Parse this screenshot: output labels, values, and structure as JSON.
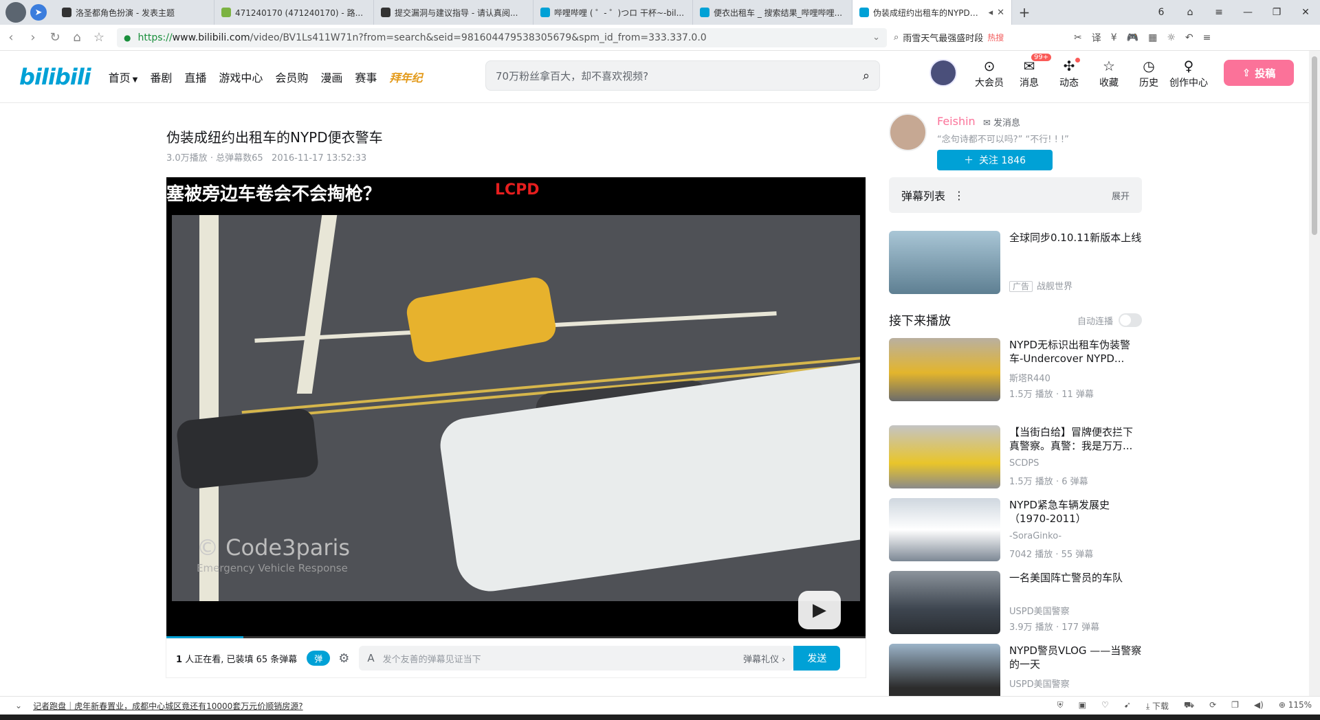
{
  "browser": {
    "tabs": [
      {
        "title": "洛圣都角色扮演 - 发表主题",
        "color": "#333333"
      },
      {
        "title": "471240170 (471240170) - 路...",
        "color": "#7cb342"
      },
      {
        "title": "提交漏洞与建议指导 - 请认真阅...",
        "color": "#333333"
      },
      {
        "title": "哔哩哔哩 ( ゜- ゜)つロ 干杯~-bil...",
        "color": "#00a1d6"
      },
      {
        "title": "便衣出租车 _ 搜索结果_哔哩哔哩...",
        "color": "#00a1d6"
      },
      {
        "title": "伪装成纽约出租车的NYPD便...",
        "color": "#00a1d6"
      }
    ],
    "tab_count": "6",
    "url_scheme": "https://",
    "url_host": "www.bilibili.com",
    "url_path": "/video/BV1Ls411W71n?from=search&seid=981604479538305679&spm_id_from=333.337.0.0",
    "search_hint": "雨雪天气最强盛时段",
    "search_hot": "热搜",
    "zoom": "115%",
    "download_label": "下载"
  },
  "site": {
    "logo": "bilibili",
    "nav": [
      "首页",
      "番剧",
      "直播",
      "游戏中心",
      "会员购",
      "漫画",
      "赛事"
    ],
    "nav_special": "拜年纪",
    "search_placeholder": "70万粉丝拿百大，却不喜欢视频?",
    "header_items": [
      {
        "label": "大会员",
        "icon": "vip-icon"
      },
      {
        "label": "消息",
        "icon": "message-icon",
        "badge": "99+"
      },
      {
        "label": "动态",
        "icon": "dynamic-icon"
      },
      {
        "label": "收藏",
        "icon": "favorite-icon"
      },
      {
        "label": "历史",
        "icon": "history-icon"
      },
      {
        "label": "创作中心",
        "icon": "creator-icon"
      }
    ],
    "upload_label": "投稿"
  },
  "video": {
    "title": "伪装成纽约出租车的NYPD便衣警车",
    "views": "3.0万播放",
    "danmaku_total": "总弹幕数65",
    "date": "2016-11-17 13:52:33",
    "overlay_caption": "塞被旁边车卷会不会掏枪？",
    "overlay_label": "LCPD",
    "watermark": "© Code3paris",
    "watermark_sub": "Emergency Vehicle Response",
    "progress": 0.11,
    "watching_count": "1",
    "watching_text": "人正在看, 已装填 65 条弹幕",
    "danmaku_toggle": "弹",
    "danmaku_placeholder": "发个友善的弹幕见证当下",
    "danmaku_etiquette": "弹幕礼仪",
    "send_label": "发送"
  },
  "uploader": {
    "name": "Feishin",
    "message_label": "发消息",
    "signature": "“念句诗都不可以吗?” “不行! ! !”",
    "follow_label": "关注 1846"
  },
  "sidebar": {
    "danmaku_list_label": "弹幕列表",
    "expand_label": "展开",
    "ad": {
      "title": "全球同步0.10.11新版本上线",
      "tag": "广告",
      "source": "战舰世界"
    },
    "next_label": "接下来播放",
    "autoplay_label": "自动连播",
    "recommendations": [
      {
        "title": "NYPD无标识出租车伪装警车-Undercover NYPD...",
        "author": "斯塔R440",
        "stats": "1.5万 播放 · 11 弹幕"
      },
      {
        "title": "【当街白给】冒牌便衣拦下真警察。真警：我是万万...",
        "author": "SCDPS",
        "stats": "1.5万 播放 · 6 弹幕"
      },
      {
        "title": "NYPD紧急车辆发展史（1970-2011）",
        "author": "-SoraGinko-",
        "stats": "7042 播放 · 55 弹幕"
      },
      {
        "title": "一名美国阵亡警员的车队",
        "author": "USPD美国警察",
        "stats": "3.9万 播放 · 177 弹幕"
      },
      {
        "title": "NYPD警员VLOG ——当警察的一天",
        "author": "USPD美国警察",
        "stats": ""
      }
    ]
  },
  "statusbar": {
    "news": "记者跑盘｜虎年新春置业，成都中心城区竟还有10000套万元价顺销房源?"
  }
}
